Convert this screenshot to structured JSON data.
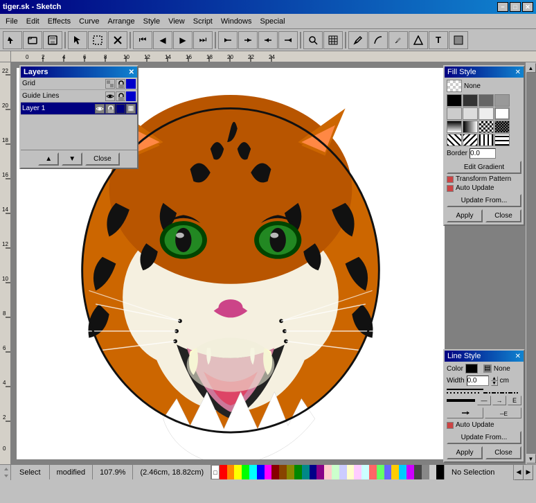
{
  "titlebar": {
    "title": "tiger.sk - Sketch",
    "close_btn": "✕",
    "max_btn": "□",
    "min_btn": "−"
  },
  "menubar": {
    "items": [
      "File",
      "Edit",
      "Effects",
      "Curve",
      "Arrange",
      "Style",
      "View",
      "Script",
      "Windows",
      "Special"
    ]
  },
  "toolbar": {
    "buttons": [
      "🖰",
      "📄",
      "🖨",
      "✂",
      "↩",
      "↪",
      "✕",
      "⏮",
      "◀",
      "▶",
      "⏭",
      "🔍",
      "⊞",
      "⬚",
      "🖊",
      "✏",
      "🖋",
      "⛛",
      "T",
      "▣"
    ]
  },
  "layers": {
    "title": "Layers",
    "close_btn": "✕",
    "rows": [
      {
        "name": "Grid",
        "type": "grid"
      },
      {
        "name": "Guide Lines",
        "type": "guide"
      },
      {
        "name": "Layer 1",
        "type": "layer",
        "selected": true
      }
    ],
    "buttons": {
      "new": "▲",
      "delete": "▼",
      "close": "Close"
    }
  },
  "fill_style": {
    "title": "Fill Style",
    "close_btn": "✕",
    "none_label": "None",
    "border_label": "Border",
    "border_value": "0.0",
    "swatches": [
      "#000000",
      "#222222",
      "#444444",
      "#666666",
      "#888888",
      "#aaaaaa",
      "#cccccc",
      "#ffffff",
      "#330000",
      "#660000",
      "#990000",
      "#cc0000",
      "#003300",
      "#006600",
      "#009900",
      "#00cc00"
    ],
    "edit_gradient_btn": "Edit Gradient",
    "transform_pattern_btn": "Transform Pattern",
    "auto_update_label": "Auto Update",
    "update_from_btn": "Update From...",
    "apply_btn": "Apply",
    "close_btn2": "Close"
  },
  "line_style": {
    "title": "Line Style",
    "close_btn": "✕",
    "color_label": "Color",
    "none_label": "None",
    "width_label": "Width",
    "width_value": "0.0",
    "unit": "cm",
    "auto_update_label": "Auto Update",
    "update_from_btn": "Update From...",
    "apply_btn": "Apply",
    "close_btn2": "Close"
  },
  "statusbar": {
    "tool": "Select",
    "state": "modified",
    "zoom": "107.9%",
    "coords": "(2.46cm, 18.82cm)",
    "selection": "No Selection"
  },
  "palette_colors": [
    "#ff0000",
    "#ff8800",
    "#ffff00",
    "#00ff00",
    "#00ffff",
    "#0000ff",
    "#ff00ff",
    "#880000",
    "#884400",
    "#888800",
    "#008800",
    "#008888",
    "#000088",
    "#880088",
    "#ffffff",
    "#cccccc",
    "#888888",
    "#444444",
    "#000000"
  ]
}
